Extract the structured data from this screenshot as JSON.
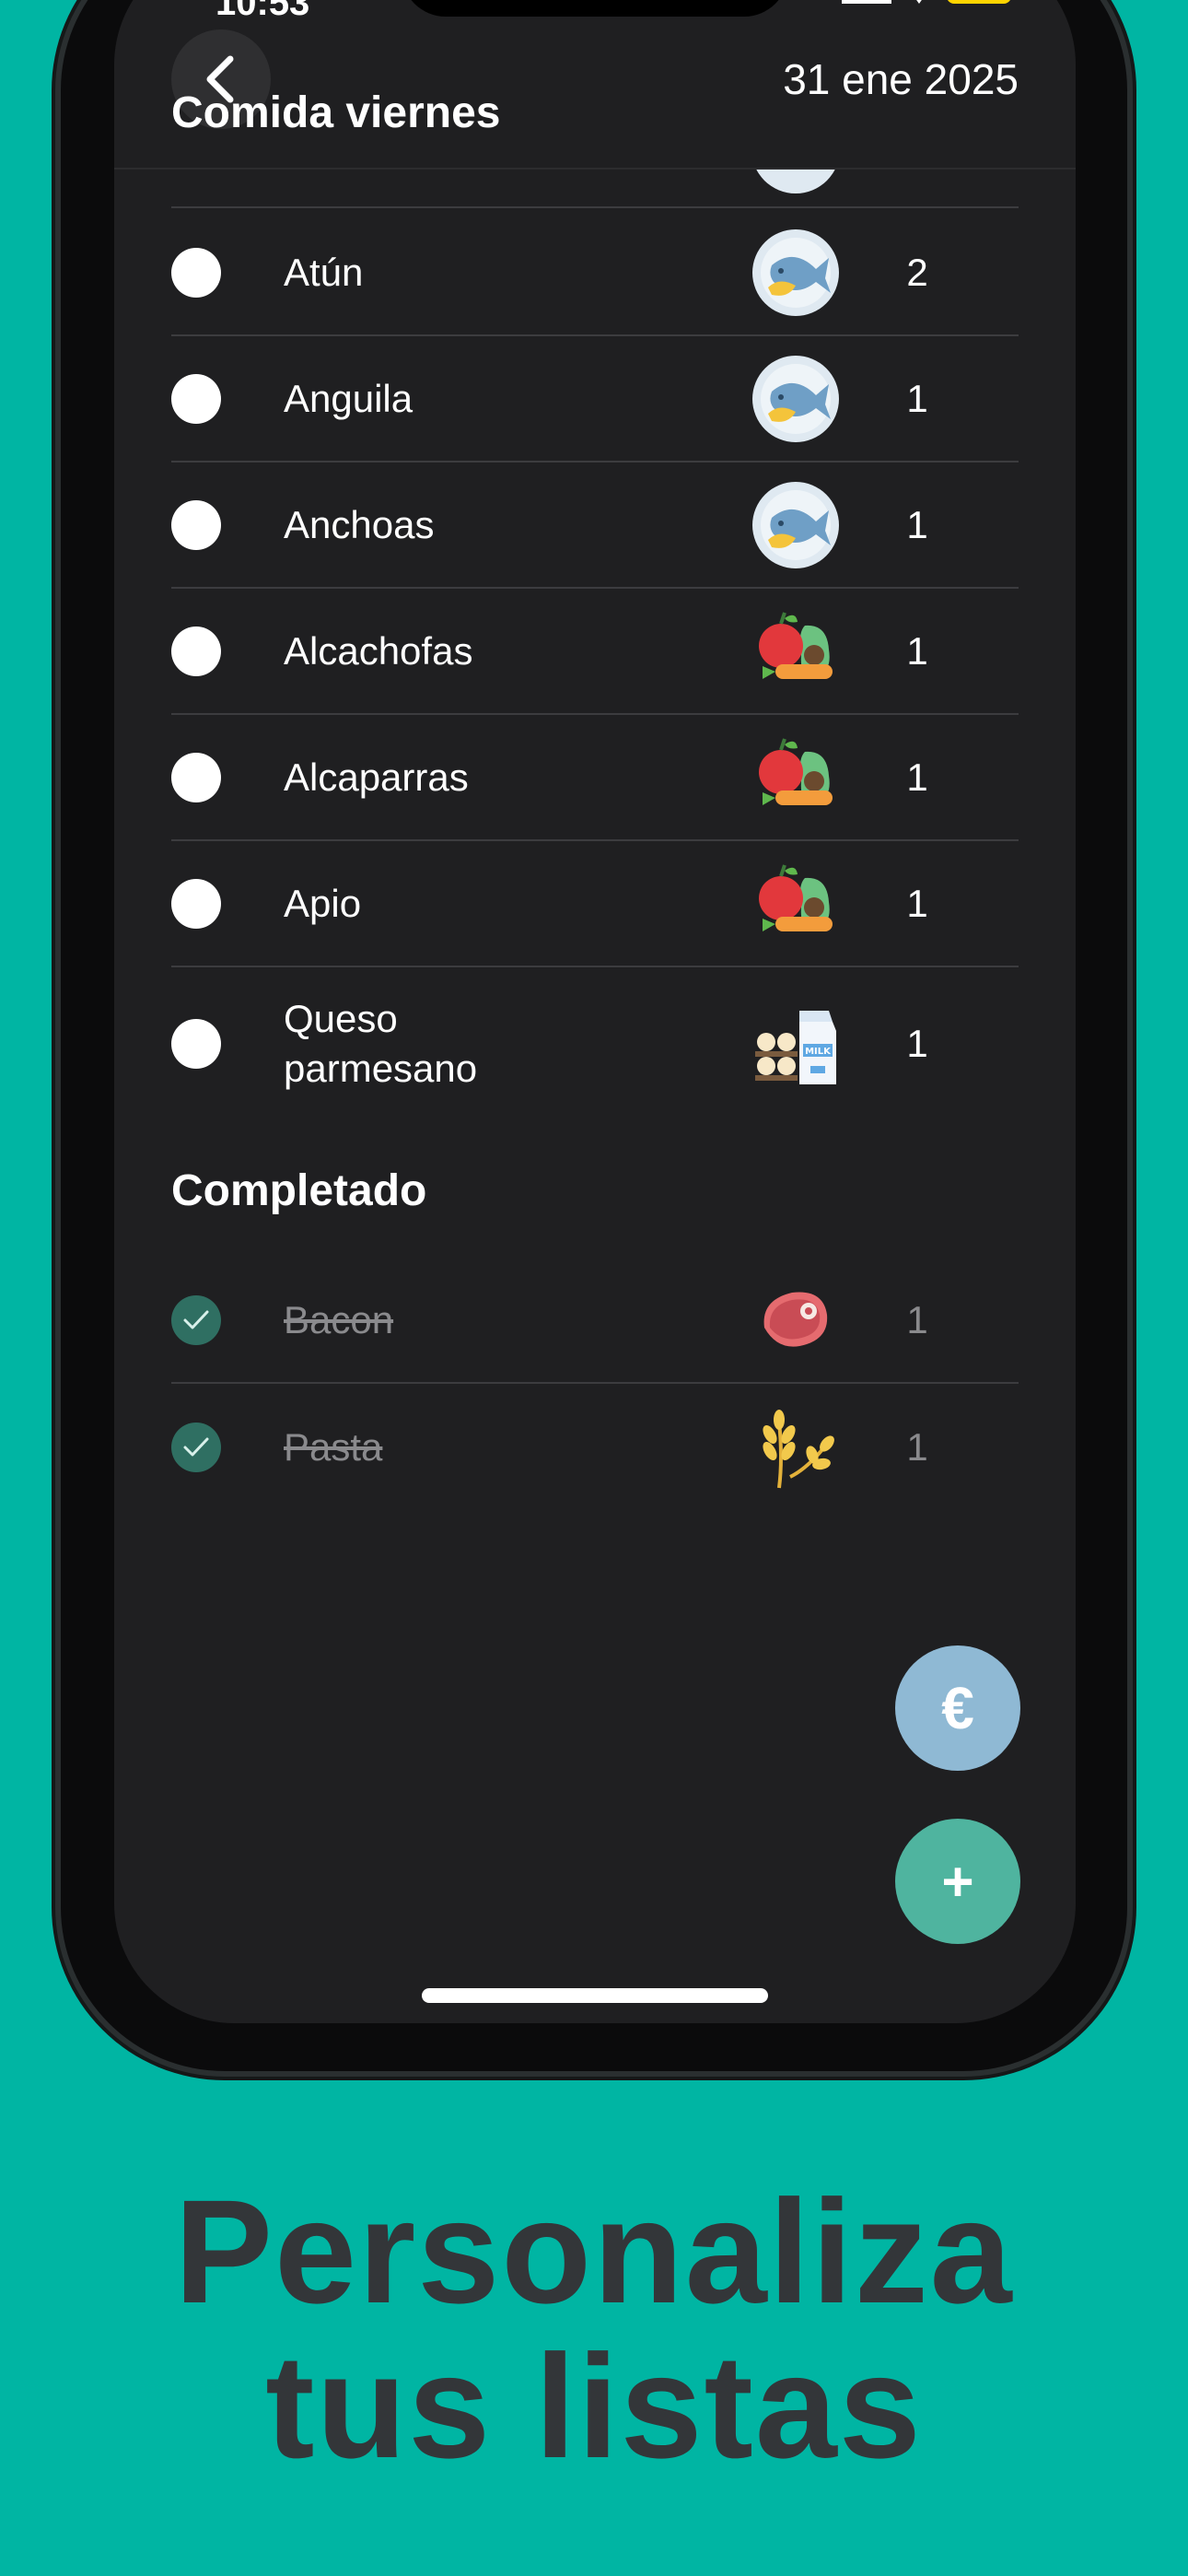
{
  "header": {
    "back_icon": "chevron-left-icon",
    "date": "31 ene 2025",
    "title": "Comida viernes"
  },
  "items": [
    {
      "name": "Atún",
      "icon": "fish-plate-icon",
      "qty": "2"
    },
    {
      "name": "Anguila",
      "icon": "fish-plate-icon",
      "qty": "1"
    },
    {
      "name": "Anchoas",
      "icon": "fish-plate-icon",
      "qty": "1"
    },
    {
      "name": "Alcachofas",
      "icon": "produce-icon",
      "qty": "1"
    },
    {
      "name": "Alcaparras",
      "icon": "produce-icon",
      "qty": "1"
    },
    {
      "name": "Apio",
      "icon": "produce-icon",
      "qty": "1"
    },
    {
      "name": "Queso parmesano",
      "icon": "dairy-icon",
      "qty": "1"
    }
  ],
  "completed": {
    "title": "Completado",
    "items": [
      {
        "name": "Bacon",
        "icon": "meat-icon",
        "qty": "1"
      },
      {
        "name": "Pasta",
        "icon": "grain-icon",
        "qty": "1"
      }
    ]
  },
  "fab": {
    "budget_label": "€",
    "budget_icon": "euro-icon",
    "add_label": "+",
    "add_icon": "plus-icon"
  },
  "promo": {
    "line1": "Personaliza",
    "line2": "tus listas"
  },
  "colors": {
    "background": "#00b5a3",
    "screen": "#1f1f21",
    "check_done": "#2f6f62",
    "fab_budget": "#8fb9d4",
    "fab_add": "#4fb49f",
    "promo_text": "#333639"
  }
}
